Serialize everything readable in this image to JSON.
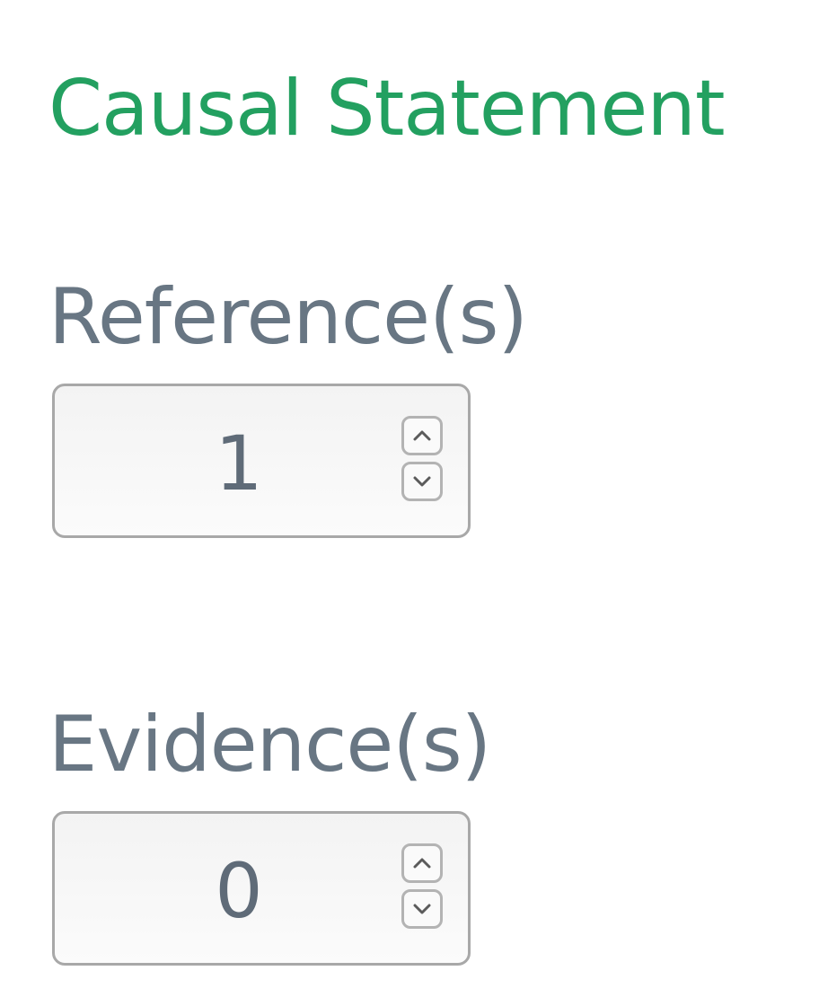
{
  "section": {
    "title": "Causal Statement"
  },
  "fields": {
    "references": {
      "label": "Reference(s)",
      "value": "1"
    },
    "evidences": {
      "label": "Evidence(s)",
      "value": "0"
    }
  },
  "icons": {
    "increment": "chevron-up-icon",
    "decrement": "chevron-down-icon"
  },
  "colors": {
    "heading": "#23a060",
    "label": "#687683",
    "value": "#5f6b78",
    "icon": "#5b5b5b"
  }
}
